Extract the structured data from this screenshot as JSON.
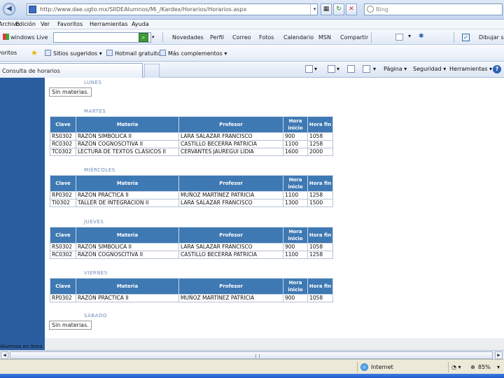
{
  "browser": {
    "url": "http://www.dae.ugto.mx/SIIDEAlumnos/Mi_/Kardex/Horarios/Horarios.aspx",
    "search_placeholder": "Bing",
    "menu": [
      "Archivo",
      "Edición",
      "Ver",
      "Favoritos",
      "Herramientas",
      "Ayuda"
    ],
    "live": {
      "brand": "windows Live",
      "links": [
        "Novedades",
        "Perfil",
        "Correo",
        "Fotos",
        "Calendario",
        "MSN",
        "Compartir"
      ],
      "checkbox_label": "Dibujar ses"
    },
    "favorites": {
      "label": "Favoritos",
      "items": [
        "Sitios sugeridos ▾",
        "Hotmail gratuito",
        "Más complementos ▾"
      ]
    },
    "tab_title": "Consulta de horarios",
    "commands": [
      "Página ▾",
      "Seguridad ▾",
      "Herramientas ▾"
    ],
    "status": {
      "zone": "Internet",
      "zoom": "85%"
    }
  },
  "schedule": {
    "headers": [
      "Clave",
      "Materia",
      "Profesor",
      "Hora inicio",
      "Hora fin"
    ],
    "no_subjects_text": "Sin materias.",
    "days": {
      "lunes": {
        "name": "LUNES"
      },
      "martes": {
        "name": "MARTES",
        "rows": [
          [
            "RS0302",
            "RAZÓN SIMBÓLICA II",
            "LARA SALAZAR FRANCISCO",
            "900",
            "1058"
          ],
          [
            "RC0302",
            "RAZÓN COGNOSCITIVA II",
            "CASTILLO BECERRA PATRICIA",
            "1100",
            "1258"
          ],
          [
            "TC0302",
            "LECTURA DE TEXTOS CLÁSICOS II",
            "CERVANTES JAUREGUI LIDIA",
            "1600",
            "2000"
          ]
        ]
      },
      "miercoles": {
        "name": "MIÉRCOLES",
        "rows": [
          [
            "RP0302",
            "RAZÓN PRÁCTICA II",
            "MUÑOZ MARTÍNEZ PATRICIA",
            "1100",
            "1258"
          ],
          [
            "TI0302",
            "TALLER DE INTEGRACIÓN II",
            "LARA SALAZAR FRANCISCO",
            "1300",
            "1500"
          ]
        ]
      },
      "jueves": {
        "name": "JUEVES",
        "rows": [
          [
            "RS0302",
            "RAZÓN SIMBÓLICA II",
            "LARA SALAZAR FRANCISCO",
            "900",
            "1058"
          ],
          [
            "RC0302",
            "RAZÓN COGNOSCITIVA II",
            "CASTILLO BECERRA PATRICIA",
            "1100",
            "1258"
          ]
        ]
      },
      "viernes": {
        "name": "VIERNES",
        "rows": [
          [
            "RP0302",
            "RAZÓN PRÁCTICA II",
            "MUÑOZ MARTÍNEZ PATRICIA",
            "900",
            "1058"
          ]
        ]
      },
      "sabado": {
        "name": "SÁBADO"
      }
    }
  },
  "left_bottom_text": "Alumnos en línea"
}
